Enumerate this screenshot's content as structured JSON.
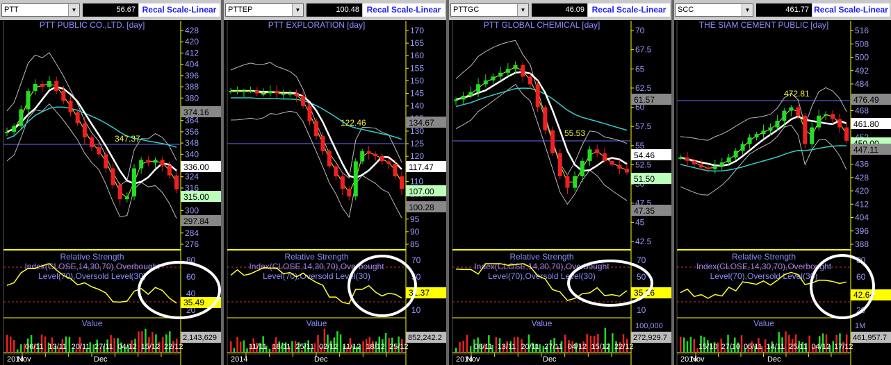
{
  "panels": [
    {
      "symbol": "PTT",
      "last": "56.67",
      "recal": "Recal Scale-Linear",
      "title": "PTT PUBLIC CO.,LTD. [day]",
      "price_ticks": [
        "428",
        "420",
        "412",
        "404",
        "396",
        "388",
        "380",
        "372",
        "364",
        "356",
        "348",
        "340",
        "332",
        "324",
        "316",
        "308",
        "300",
        "292",
        "284",
        "276"
      ],
      "price_badges": [
        {
          "text": "374.16",
          "kind": "gray"
        },
        {
          "text": "336.00",
          "kind": "white"
        },
        {
          "text": "315.00",
          "kind": "green"
        },
        {
          "text": "297.84",
          "kind": "gray"
        }
      ],
      "annotation": "347.37",
      "rsi_title": [
        "Relative Strength",
        "Index(CLOSE,14,30,70),Overbought",
        "Level(70),Oversold Level(30)"
      ],
      "rsi_ticks": [
        "80",
        "60",
        "40",
        "20"
      ],
      "rsi_badge": "35.49",
      "vol_title": "Value",
      "vol_ticks": [],
      "vol_badge": "2,143,629",
      "dates": [
        "06/11",
        "13/11",
        "20/11",
        "27/11",
        "04/12",
        "15/12",
        "22/12"
      ],
      "months": [
        "2014",
        "Nov",
        "Dec"
      ]
    },
    {
      "symbol": "PTTEP",
      "last": "100.48",
      "recal": "Recal Scale-Linear",
      "title": "PTT EXPLORATION [day]",
      "price_ticks": [
        "170",
        "165",
        "160",
        "155",
        "150",
        "145",
        "140",
        "135",
        "130",
        "125",
        "120",
        "115",
        "110",
        "105",
        "100",
        "95",
        "90",
        "85"
      ],
      "price_badges": [
        {
          "text": "134.67",
          "kind": "gray"
        },
        {
          "text": "117.47",
          "kind": "white"
        },
        {
          "text": "107.00",
          "kind": "green"
        },
        {
          "text": "100.28",
          "kind": "gray"
        }
      ],
      "annotation": "122.46",
      "rsi_title": [
        "Relative Strength",
        "Index(CLOSE,14,30,70),Overbought",
        "Level(70),Oversold Level(30)"
      ],
      "rsi_ticks": [
        "70",
        "50",
        "30",
        "10"
      ],
      "rsi_badge": "31.37",
      "vol_title": "Value",
      "vol_ticks": [],
      "vol_badge": "852,242.2",
      "dates": [
        "11/11",
        "18/11",
        "25/11",
        "02/12",
        "11/12",
        "18/12",
        "25/12"
      ],
      "months": [
        "2014",
        "Dec"
      ]
    },
    {
      "symbol": "PTTGC",
      "last": "46.09",
      "recal": "Recal Scale-Linear",
      "title": "PTT GLOBAL CHEMICAL [day]",
      "price_ticks": [
        "70",
        "67.5",
        "65",
        "62.5",
        "60",
        "57.5",
        "55",
        "52.5",
        "50",
        "47.5",
        "45",
        "42.5"
      ],
      "price_badges": [
        {
          "text": "61.57",
          "kind": "gray"
        },
        {
          "text": "54.46",
          "kind": "white"
        },
        {
          "text": "51.50",
          "kind": "green"
        },
        {
          "text": "47.35",
          "kind": "gray"
        }
      ],
      "annotation": "55.53",
      "rsi_title": [
        "Relative Strength",
        "Index(CLOSE,14,30,70),Overbought",
        "Level(70),Oversold Level(30)"
      ],
      "rsi_ticks": [
        "70",
        "50",
        "30",
        "10"
      ],
      "rsi_badge": "35.26",
      "vol_title": "Value",
      "vol_ticks": [
        "100,000"
      ],
      "vol_badge": "272,929.7",
      "dates": [
        "06/11",
        "13/11",
        "20/11",
        "27/11",
        "04/12",
        "15/12",
        "22/12"
      ],
      "months": [
        "2014",
        "Nov",
        "Dec"
      ]
    },
    {
      "symbol": "SCC",
      "last": "461.77",
      "recal": "Recal Scale-Linear",
      "title": "THE SIAM CEMENT PUBLIC [day]",
      "price_ticks": [
        "516",
        "508",
        "500",
        "492",
        "484",
        "476",
        "468",
        "460",
        "452",
        "444",
        "436",
        "428",
        "420",
        "412",
        "404",
        "396",
        "388"
      ],
      "price_badges": [
        {
          "text": "476.49",
          "kind": "gray"
        },
        {
          "text": "461.80",
          "kind": "white"
        },
        {
          "text": "450.00",
          "kind": "green"
        },
        {
          "text": "447.11",
          "kind": "gray"
        }
      ],
      "annotation": "472.81",
      "rsi_title": [
        "Relative Strength",
        "Index(CLOSE,14,30,70),Overbought",
        "Level(70),Oversold Level(30)"
      ],
      "rsi_ticks": [
        "80",
        "60",
        "40",
        "20"
      ],
      "rsi_badge": "42.64",
      "vol_title": "Value",
      "vol_ticks": [
        "1M"
      ],
      "vol_badge": "461,957.7",
      "dates": [
        "15/10",
        "27/10",
        "05/11",
        "14/11",
        "25/11",
        "04/12",
        "17/12"
      ],
      "months": [
        "2014",
        "Nov",
        "Dec"
      ]
    }
  ],
  "colors": {
    "up": "#22dd22",
    "down": "#ee2020",
    "rsi": "#ffff33",
    "axis": "#ffff00",
    "tick": "#9999ff",
    "title": "#8c8cff",
    "upper_band": "#bbbbbb",
    "ma_white": "#ffffff",
    "ma_cyan": "#33cccc",
    "hline": "#6b6bff",
    "circle": "#ffffff"
  },
  "chart_data": [
    {
      "type": "candlestick",
      "title": "PTT PUBLIC CO.,LTD. [day]",
      "close_series_approx": [
        356,
        360,
        372,
        385,
        390,
        388,
        392,
        385,
        378,
        370,
        362,
        352,
        345,
        340,
        330,
        318,
        308,
        310,
        330,
        336,
        334,
        336,
        332,
        325,
        315
      ],
      "ylim": [
        276,
        428
      ]
    },
    {
      "type": "candlestick",
      "title": "PTT EXPLORATION [day]",
      "close_series_approx": [
        146,
        146,
        146,
        146,
        145,
        145,
        146,
        145,
        145,
        145,
        144,
        140,
        134,
        128,
        122,
        116,
        112,
        107,
        104,
        118,
        122,
        121,
        120,
        118,
        117,
        112,
        107
      ],
      "ylim": [
        85,
        170
      ]
    },
    {
      "type": "candlestick",
      "title": "PTT GLOBAL CHEMICAL [day]",
      "close_series_approx": [
        61,
        61.5,
        62,
        63,
        63.5,
        64,
        64.5,
        65,
        65.5,
        64,
        63,
        60,
        57,
        54,
        51,
        49.5,
        51,
        53,
        54.5,
        54,
        53,
        52.5,
        52,
        51.5
      ],
      "ylim": [
        42.5,
        70
      ]
    },
    {
      "type": "candlestick",
      "title": "THE SIAM CEMENT PUBLIC [day]",
      "close_series_approx": [
        440,
        438,
        436,
        434,
        433,
        435,
        437,
        440,
        444,
        448,
        452,
        454,
        456,
        458,
        462,
        468,
        470,
        465,
        448,
        458,
        465,
        466,
        463,
        458,
        450
      ],
      "ylim": [
        388,
        516
      ]
    }
  ]
}
